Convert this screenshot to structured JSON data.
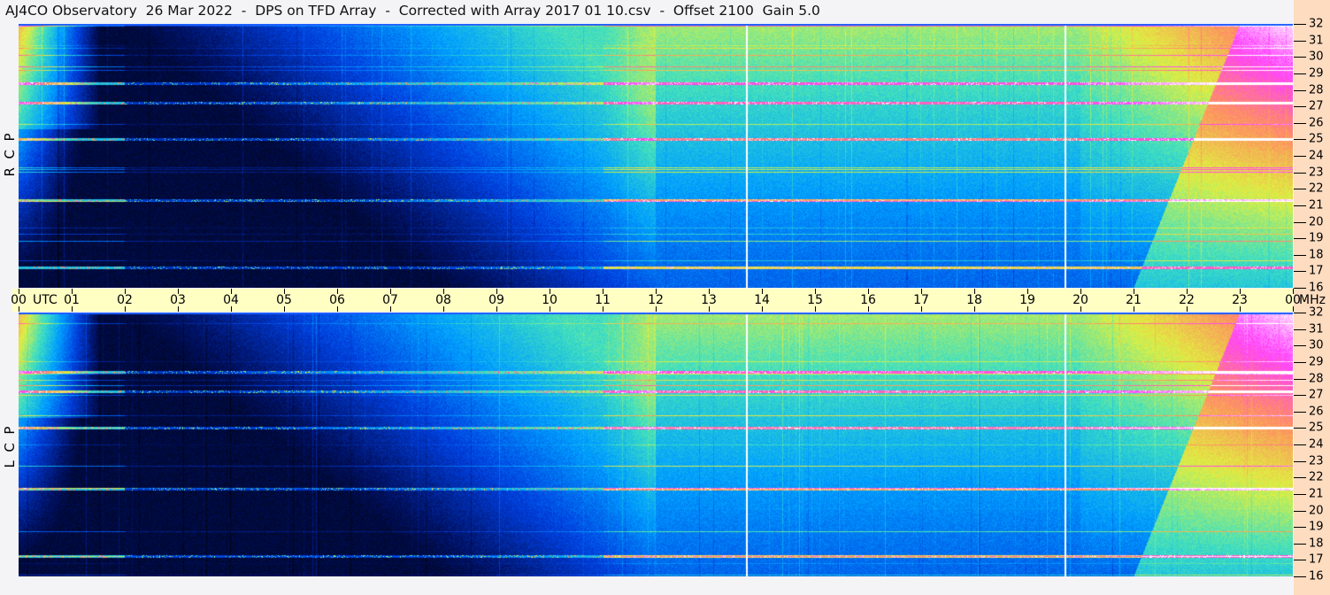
{
  "title": "AJ4CO Observatory  26 Mar 2022  -  DPS on TFD Array  -  Corrected with Array 2017 01 10.csv  -  Offset 2100  Gain 5.0",
  "panels": [
    {
      "polarization": "R  C  P"
    },
    {
      "polarization": "L  C  P"
    }
  ],
  "time_axis": {
    "unit": "UTC",
    "labels": [
      "00",
      "01",
      "02",
      "03",
      "04",
      "05",
      "06",
      "07",
      "08",
      "09",
      "10",
      "11",
      "12",
      "13",
      "14",
      "15",
      "16",
      "17",
      "18",
      "19",
      "20",
      "21",
      "22",
      "23",
      "00"
    ]
  },
  "freq_axis": {
    "unit": "MHz",
    "labels": [
      "16",
      "17",
      "18",
      "19",
      "20",
      "21",
      "22",
      "23",
      "24",
      "25",
      "26",
      "27",
      "28",
      "29",
      "30",
      "31",
      "32"
    ]
  },
  "chart_data": {
    "type": "heatmap",
    "title": "AJ4CO Observatory 26 Mar 2022 - DPS on TFD Array",
    "xlabel": "UTC",
    "ylabel": "MHz",
    "xlim": [
      0,
      24
    ],
    "ylim": [
      16,
      32
    ],
    "series": [
      {
        "name": "RCP"
      },
      {
        "name": "LCP"
      }
    ],
    "colormap": [
      "#000000",
      "#001060",
      "#0040e0",
      "#00a0ff",
      "#40e0c0",
      "#e0f040",
      "#ff9060",
      "#ff40ff",
      "#ffffff"
    ],
    "vertical_markers_utc": [
      13.7,
      19.7
    ],
    "interference_bands_mhz": [
      17.2,
      21.3,
      27.2,
      28.4,
      25.0
    ]
  }
}
